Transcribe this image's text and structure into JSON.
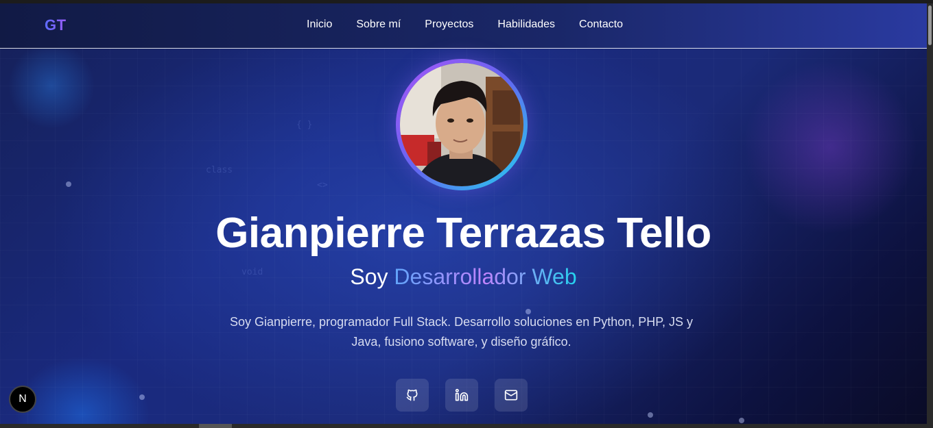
{
  "nav": {
    "logo": "GT",
    "links": [
      {
        "label": "Inicio"
      },
      {
        "label": "Sobre mí"
      },
      {
        "label": "Proyectos"
      },
      {
        "label": "Habilidades"
      },
      {
        "label": "Contacto"
      }
    ]
  },
  "hero": {
    "name": "Gianpierre Terrazas Tello",
    "subtitle_prefix": "Soy",
    "subtitle_role": "Desarrollador Web",
    "description": "Soy Gianpierre, programador Full Stack. Desarrollo soluciones en Python, PHP, JS y Java, fusiono software, y diseño gráfico.",
    "socials": [
      {
        "icon": "github-icon"
      },
      {
        "icon": "linkedin-icon"
      },
      {
        "icon": "mail-icon"
      }
    ]
  },
  "dev_badge": {
    "label": "N"
  },
  "colors": {
    "accent_purple": "#a855f7",
    "accent_blue": "#60a5fa",
    "accent_cyan": "#22d3ee",
    "background": "#1a2a80"
  }
}
